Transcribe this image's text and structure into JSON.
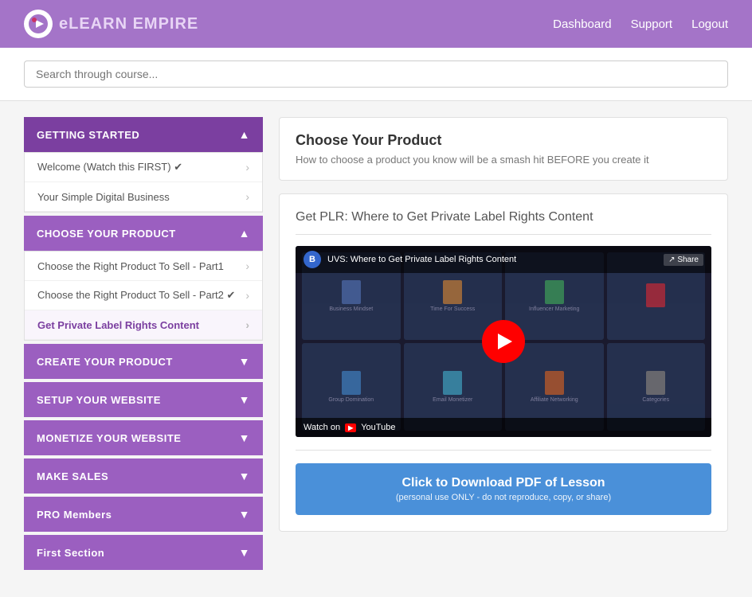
{
  "header": {
    "logo_text_elearn": "eLEARN",
    "logo_text_empire": " EMPIRE",
    "nav": {
      "dashboard": "Dashboard",
      "support": "Support",
      "logout": "Logout"
    }
  },
  "search": {
    "placeholder": "Search through course..."
  },
  "sidebar": {
    "sections": [
      {
        "id": "getting-started",
        "label": "GETTING STARTED",
        "expanded": true,
        "items": [
          {
            "label": "Welcome (Watch this FIRST) ✔",
            "active": false
          },
          {
            "label": "Your Simple Digital Business",
            "active": false
          }
        ]
      },
      {
        "id": "choose-your-product",
        "label": "CHOOSE YOUR PRODUCT",
        "expanded": true,
        "items": [
          {
            "label": "Choose the Right Product To Sell - Part1",
            "active": false
          },
          {
            "label": "Choose the Right Product To Sell - Part2 ✔",
            "active": false
          },
          {
            "label": "Get Private Label Rights Content",
            "active": true
          }
        ]
      },
      {
        "id": "create-your-product",
        "label": "CREATE YOUR PRODUCT",
        "expanded": false,
        "items": []
      },
      {
        "id": "setup-your-website",
        "label": "SETUP YOUR WEBSITE",
        "expanded": false,
        "items": []
      },
      {
        "id": "monetize-your-website",
        "label": "MONETIZE YOUR WEBSITE",
        "expanded": false,
        "items": []
      },
      {
        "id": "make-sales",
        "label": "MAKE SALES",
        "expanded": false,
        "items": []
      },
      {
        "id": "pro-members",
        "label": "PRO Members",
        "expanded": false,
        "items": []
      },
      {
        "id": "first-section",
        "label": "First Section",
        "expanded": false,
        "items": []
      }
    ]
  },
  "main": {
    "lesson_header": {
      "title": "Choose Your Product",
      "subtitle": "How to choose a product you know will be a smash hit BEFORE you create it"
    },
    "video_section": {
      "title_prefix": "Get PLR:",
      "title_main": " Where to Get Private Label Rights Content",
      "video_top_badge": "B",
      "video_top_title": "UVS: Where to Get Private Label Rights Content",
      "video_share": "Share",
      "watch_on_label": "Watch on",
      "youtube_label": "YouTube"
    },
    "download_btn": {
      "label": "Click to Download PDF of Lesson",
      "sublabel": "(personal use ONLY - do not reproduce, copy, or share)"
    }
  }
}
